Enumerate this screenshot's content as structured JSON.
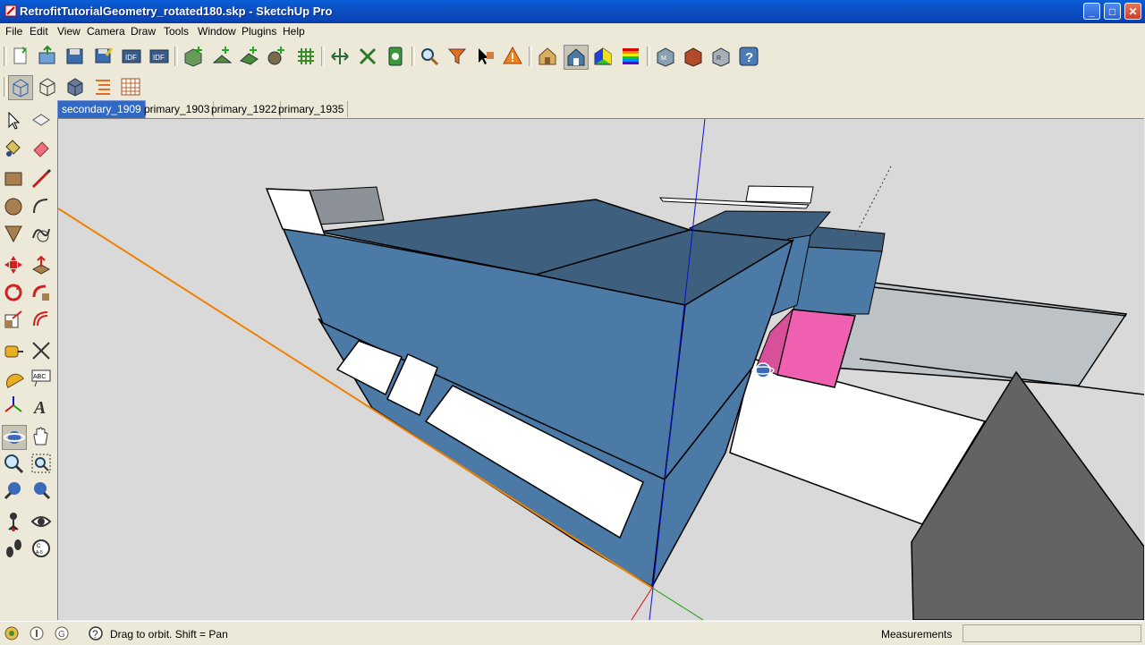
{
  "window": {
    "title": "RetrofitTutorialGeometry_rotated180.skp - SketchUp Pro",
    "controls": {
      "minimize": "_",
      "maximize": "□",
      "close": "✕"
    }
  },
  "menu": [
    "File",
    "Edit",
    "View",
    "Camera",
    "Draw",
    "Tools",
    "Window",
    "Plugins",
    "Help"
  ],
  "scenes": {
    "tabs": [
      "secondary_1909",
      "primary_1903",
      "primary_1922",
      "primary_1935"
    ],
    "active": 0
  },
  "status": {
    "hint": "Drag to orbit.  Shift = Pan",
    "measurements_label": "Measurements",
    "measurements_value": ""
  },
  "colors": {
    "building_top": "#3f5f7e",
    "building_side": "#4a7aa5",
    "selected_face": "#f060b0",
    "window_white": "#ffffff",
    "shade_gray": "#bcc2c6",
    "dark_gray": "#636363",
    "axis_red": "#d01010",
    "axis_green": "#10a010",
    "axis_blue": "#1010d0",
    "orange_edge": "#f08000"
  }
}
